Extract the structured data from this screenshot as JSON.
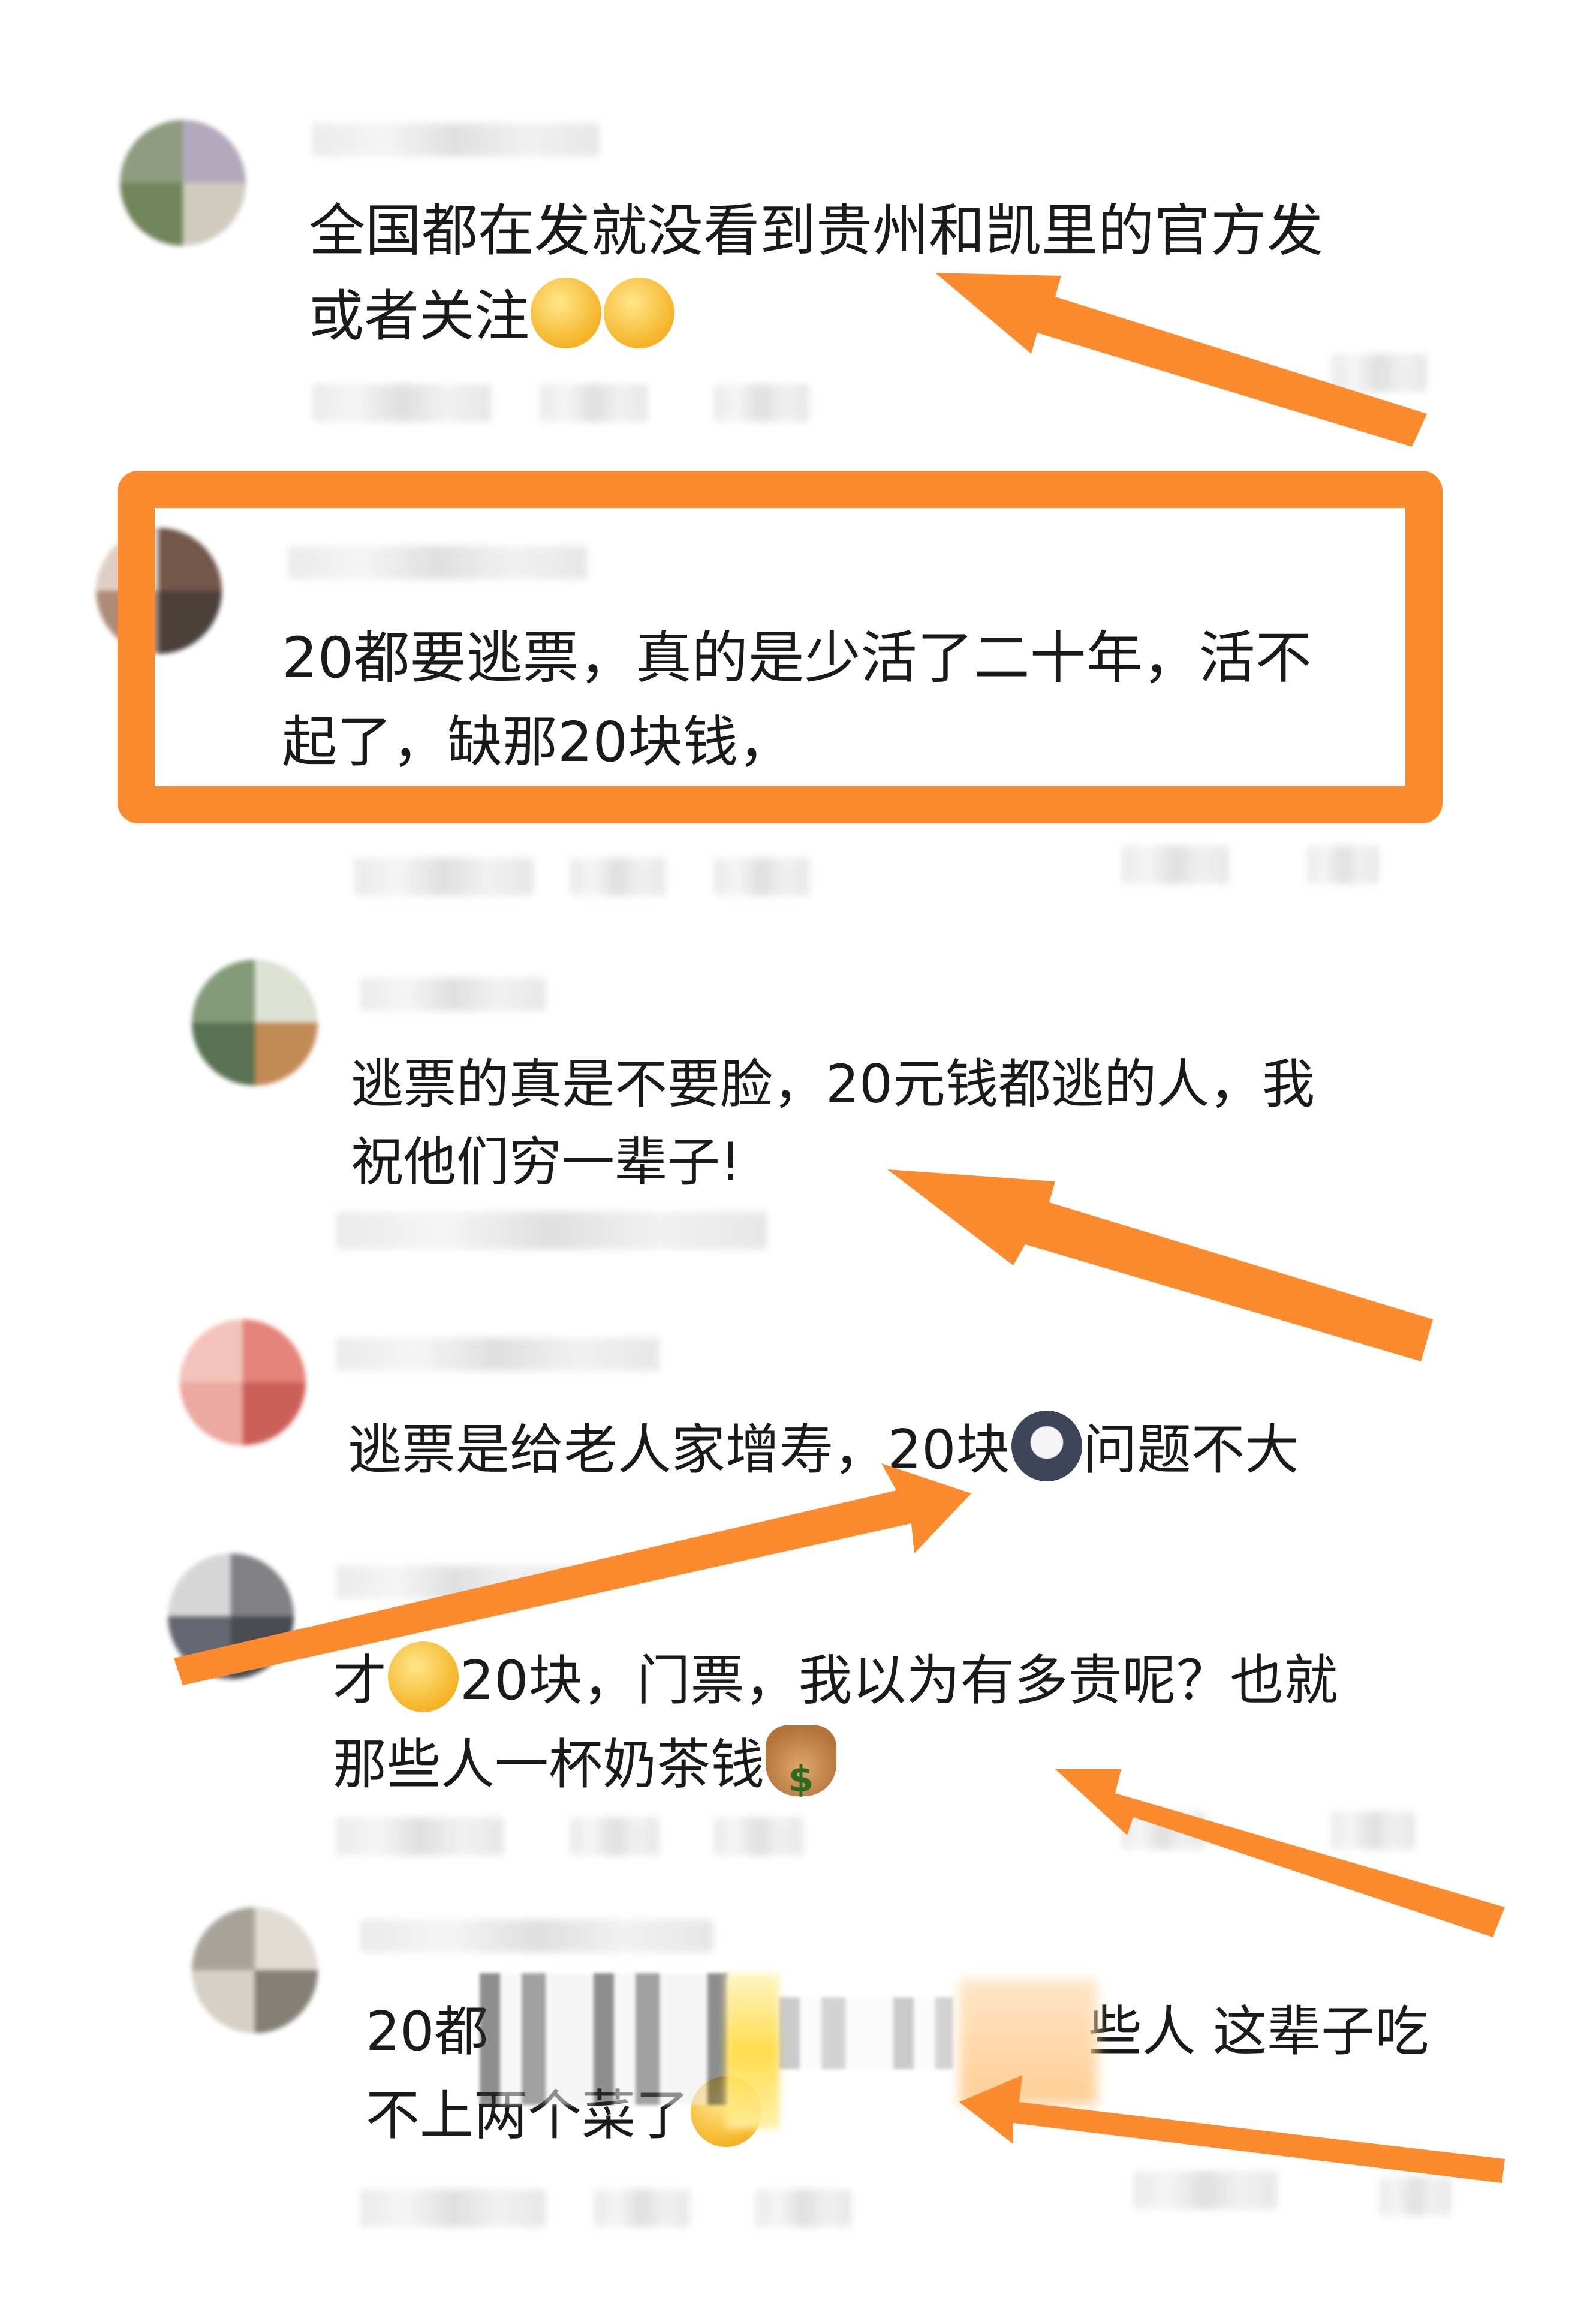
{
  "colors": {
    "accent": "#fb8b2e",
    "text": "#1a1a1a",
    "background": "#ffffff"
  },
  "comments": [
    {
      "line1": "全国都在发就没看到贵州和凯里的官方发",
      "line2": "或者关注",
      "emojis": [
        "shushing-face",
        "shushing-face"
      ]
    },
    {
      "line1": "20都要逃票，真的是少活了二十年，活不",
      "line2": "起了，缺那20块钱，",
      "highlighted": true
    },
    {
      "line1": "逃票的真是不要脸，20元钱都逃的人，我",
      "line2": "祝他们穷一辈子!"
    },
    {
      "line1_a": "逃票是给老人家增寿，20块",
      "line1_b": "问题不大",
      "emojis": [
        "wolf-face"
      ]
    },
    {
      "line1_a": "才",
      "line1_b": "20块，门票，我以为有多贵呢？也就",
      "line2_a": "那些人一杯奶茶钱",
      "emojis": [
        "pleading-face",
        "money-bag"
      ]
    },
    {
      "line1_a": "20都",
      "line1_b": "些人 这辈子吃",
      "line2": "不上两个菜了",
      "emojis": [
        "unamused-face"
      ]
    }
  ]
}
